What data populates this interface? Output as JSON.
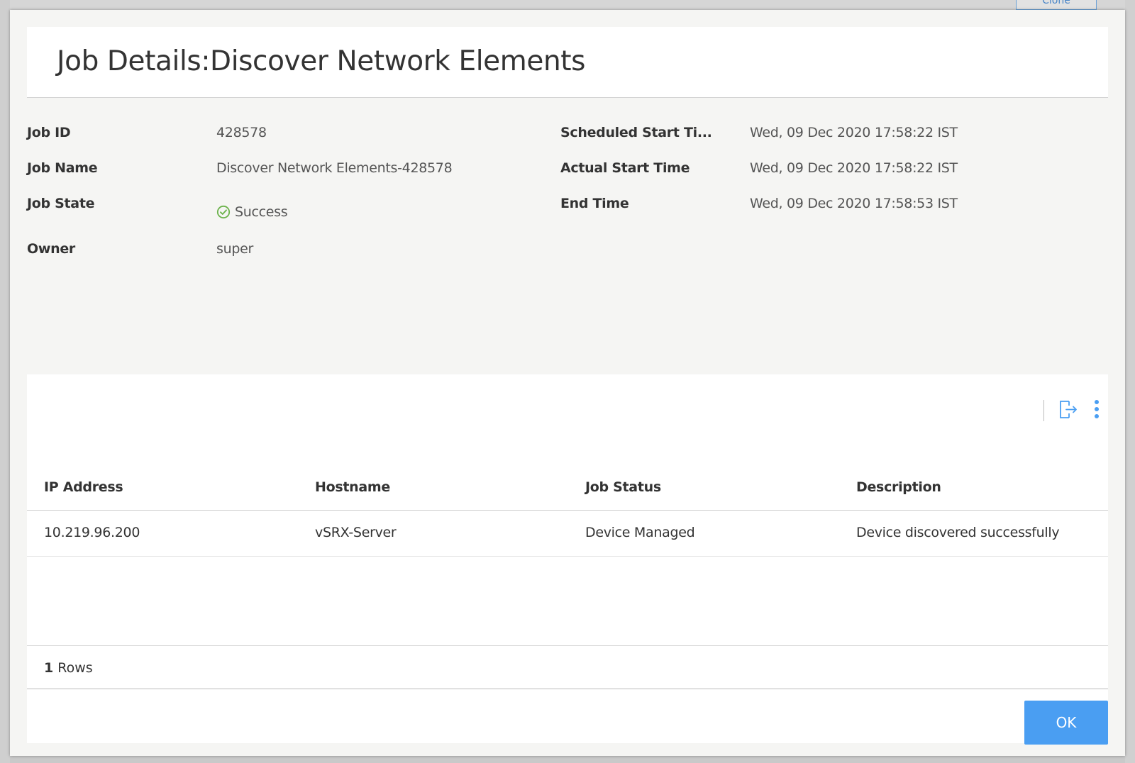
{
  "background": {
    "top_button_label": "Clone"
  },
  "dialog": {
    "title": "Job Details:Discover Network Elements",
    "fields": {
      "job_id": {
        "label": "Job ID",
        "value": "428578"
      },
      "job_name": {
        "label": "Job Name",
        "value": "Discover Network Elements-428578"
      },
      "job_state": {
        "label": "Job State",
        "value": "Success",
        "icon": "check-circle-icon",
        "icon_color": "#6bb24a"
      },
      "owner": {
        "label": "Owner",
        "value": "super"
      },
      "scheduled_start": {
        "label": "Scheduled Start Ti...",
        "value": "Wed, 09 Dec 2020 17:58:22 IST"
      },
      "actual_start": {
        "label": "Actual Start Time",
        "value": "Wed, 09 Dec 2020 17:58:22 IST"
      },
      "end_time": {
        "label": "End Time",
        "value": "Wed, 09 Dec 2020 17:58:53 IST"
      }
    },
    "toolbar": {
      "export_icon": "export-icon",
      "more_icon": "more-vertical-icon",
      "icon_color": "#4a9ef2"
    },
    "table": {
      "columns": [
        "IP Address",
        "Hostname",
        "Job Status",
        "Description"
      ],
      "rows": [
        [
          "10.219.96.200",
          "vSRX-Server",
          "Device Managed",
          "Device discovered successfully"
        ]
      ],
      "footer_count": "1",
      "footer_label": "Rows"
    },
    "ok_label": "OK",
    "accent_color": "#4a9ef2"
  }
}
